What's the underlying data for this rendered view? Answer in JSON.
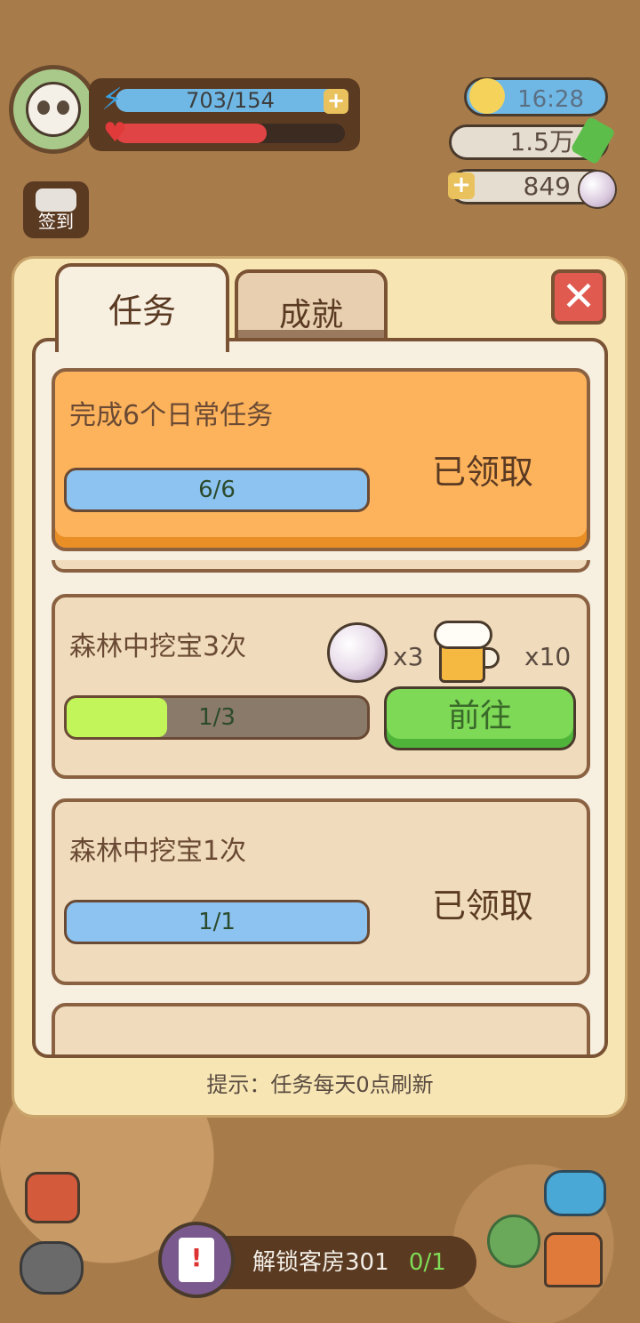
{
  "hud": {
    "energy_text": "703/154",
    "energy_plus": "+",
    "health_fraction": 0.66,
    "time": "16:28",
    "money": "1.5万",
    "pearls": "849",
    "pearl_plus": "+",
    "checkin_label": "签到"
  },
  "modal": {
    "tabs": [
      {
        "label": "任务",
        "active": true
      },
      {
        "label": "成就",
        "active": false
      }
    ],
    "close_label": "✕",
    "tasks": [
      {
        "title": "完成6个日常任务",
        "progress_text": "6/6",
        "progress": 1.0,
        "status": "已领取"
      },
      {
        "title": "森林中挖宝3次",
        "progress_text": "1/3",
        "progress": 0.333,
        "rewards": [
          {
            "icon": "pearl-icon",
            "qty": "x3"
          },
          {
            "icon": "beer-icon",
            "qty": "x10"
          }
        ],
        "action": "前往"
      },
      {
        "title": "森林中挖宝1次",
        "progress_text": "1/1",
        "progress": 1.0,
        "status": "已领取"
      }
    ],
    "hint": "提示：任务每天0点刷新"
  },
  "bottom": {
    "unlock_label": "解锁客房301",
    "unlock_count": "0/1"
  },
  "colors": {
    "accent_orange": "#fdb35c",
    "go_green": "#7ed957",
    "progress_blue": "#8cc3f0",
    "progress_green": "#c2f55a",
    "frame_brown": "#7a5234"
  }
}
